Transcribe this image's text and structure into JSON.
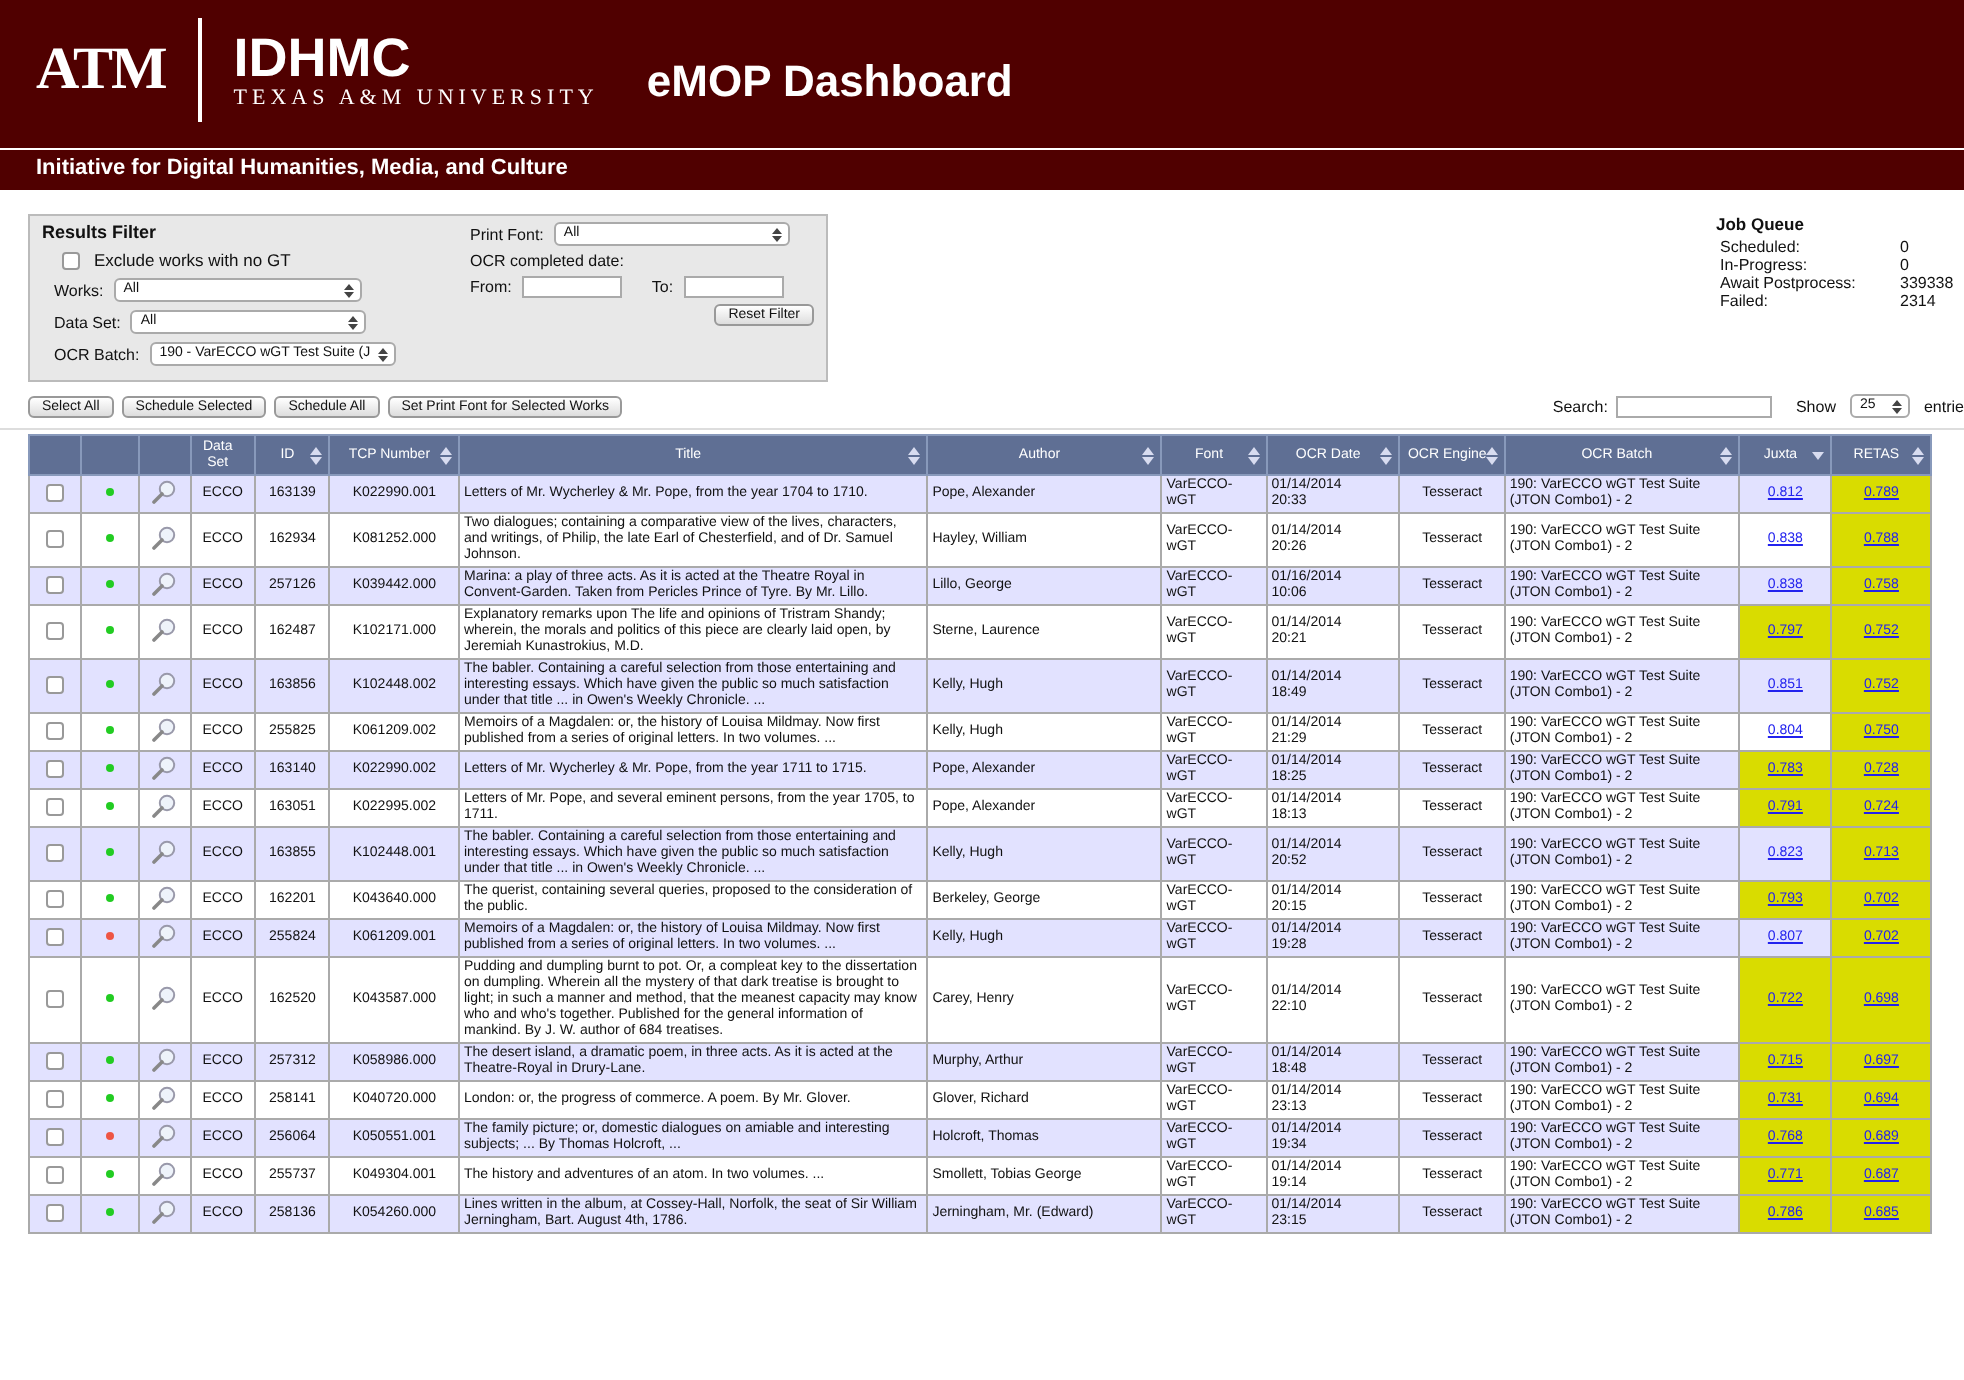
{
  "header": {
    "logo": "ATM",
    "org": "IDHMC",
    "university": "TEXAS A&M UNIVERSITY",
    "title": "eMOP Dashboard",
    "subtitle": "Initiative for Digital Humanities, Media, and Culture"
  },
  "filter": {
    "title": "Results Filter",
    "exclude": {
      "label": "Exclude works with no GT",
      "checked": false
    },
    "selects": [
      {
        "label": "Works:",
        "value": "All"
      },
      {
        "label": "Data Set:",
        "value": "All"
      },
      {
        "label": "OCR Batch:",
        "value": "190 - VarECCO wGT Test Suite (J"
      }
    ],
    "print_font": {
      "label": "Print Font:",
      "value": "All"
    },
    "date_label": "OCR completed date:",
    "from_label": "From:",
    "to_label": "To:",
    "reset": "Reset Filter"
  },
  "job_queue": {
    "title": "Job Queue",
    "items": [
      {
        "label": "Scheduled:",
        "value": "0"
      },
      {
        "label": "In-Progress:",
        "value": "0"
      },
      {
        "label": "Await Postprocess:",
        "value": "339338"
      },
      {
        "label": "Failed:",
        "value": "2314"
      }
    ]
  },
  "actions": [
    "Select All",
    "Schedule Selected",
    "Schedule All",
    "Set Print Font for Selected Works"
  ],
  "search_label": "Search:",
  "show_label": "Show",
  "show_value": "25",
  "entries_label": "entrie",
  "table": {
    "columns": [
      {
        "label": "Data Set",
        "sortable": false,
        "sorted": false
      },
      {
        "label": "ID",
        "sortable": true,
        "sorted": false
      },
      {
        "label": "TCP Number",
        "sortable": true,
        "sorted": false
      },
      {
        "label": "Title",
        "sortable": true,
        "sorted": false
      },
      {
        "label": "Author",
        "sortable": true,
        "sorted": false
      },
      {
        "label": "Font",
        "sortable": true,
        "sorted": false
      },
      {
        "label": "OCR Date",
        "sortable": true,
        "sorted": false
      },
      {
        "label": "OCR Engine",
        "sortable": true,
        "sorted": false
      },
      {
        "label": "OCR Batch",
        "sortable": true,
        "sorted": false
      },
      {
        "label": "Juxta",
        "sortable": true,
        "sorted": true
      },
      {
        "label": "RETAS",
        "sortable": true,
        "sorted": false
      }
    ],
    "rows": [
      {
        "checked": false,
        "color": "#22cc22",
        "dataset": "ECCO",
        "id": "163139",
        "tcp": "K022990.001",
        "title": "Letters of Mr. Wycherley & Mr. Pope, from the year 1704 to 1710.",
        "author": "Pope, Alexander",
        "font": "VarECCO-wGT",
        "date": "01/14/2014 20:33",
        "engine": "Tesseract",
        "batch": "190: VarECCO wGT Test Suite (JTON Combo1) - 2",
        "juxta": {
          "value": "0.812",
          "highlighted": false
        },
        "retas": {
          "value": "0.789",
          "highlighted": true
        }
      },
      {
        "checked": false,
        "color": "#22cc22",
        "dataset": "ECCO",
        "id": "162934",
        "tcp": "K081252.000",
        "title": "Two dialogues; containing a comparative view of the lives, characters, and writings, of Philip, the late Earl of Chesterfield, and of Dr. Samuel Johnson.",
        "author": "Hayley, William",
        "font": "VarECCO-wGT",
        "date": "01/14/2014 20:26",
        "engine": "Tesseract",
        "batch": "190: VarECCO wGT Test Suite (JTON Combo1) - 2",
        "juxta": {
          "value": "0.838",
          "highlighted": false
        },
        "retas": {
          "value": "0.788",
          "highlighted": true
        }
      },
      {
        "checked": false,
        "color": "#22cc22",
        "dataset": "ECCO",
        "id": "257126",
        "tcp": "K039442.000",
        "title": "Marina: a play of three acts. As it is acted at the Theatre Royal in Convent-Garden. Taken from Pericles Prince of Tyre. By Mr. Lillo.",
        "author": "Lillo, George",
        "font": "VarECCO-wGT",
        "date": "01/16/2014 10:06",
        "engine": "Tesseract",
        "batch": "190: VarECCO wGT Test Suite (JTON Combo1) - 2",
        "juxta": {
          "value": "0.838",
          "highlighted": false
        },
        "retas": {
          "value": "0.758",
          "highlighted": true
        }
      },
      {
        "checked": false,
        "color": "#22cc22",
        "dataset": "ECCO",
        "id": "162487",
        "tcp": "K102171.000",
        "title": "Explanatory remarks upon The life and opinions of Tristram Shandy; wherein, the morals and politics of this piece are clearly laid open, by Jeremiah Kunastrokius, M.D.",
        "author": "Sterne, Laurence",
        "font": "VarECCO-wGT",
        "date": "01/14/2014 20:21",
        "engine": "Tesseract",
        "batch": "190: VarECCO wGT Test Suite (JTON Combo1) - 2",
        "juxta": {
          "value": "0.797",
          "highlighted": true
        },
        "retas": {
          "value": "0.752",
          "highlighted": true
        }
      },
      {
        "checked": false,
        "color": "#22cc22",
        "dataset": "ECCO",
        "id": "163856",
        "tcp": "K102448.002",
        "title": "The babler. Containing a careful selection from those entertaining and interesting essays. Which have given the public so much satisfaction under that title ... in Owen's Weekly Chronicle. ...",
        "author": "Kelly, Hugh",
        "font": "VarECCO-wGT",
        "date": "01/14/2014 18:49",
        "engine": "Tesseract",
        "batch": "190: VarECCO wGT Test Suite (JTON Combo1) - 2",
        "juxta": {
          "value": "0.851",
          "highlighted": false
        },
        "retas": {
          "value": "0.752",
          "highlighted": true
        }
      },
      {
        "checked": false,
        "color": "#22cc22",
        "dataset": "ECCO",
        "id": "255825",
        "tcp": "K061209.002",
        "title": "Memoirs of a Magdalen: or, the history of Louisa Mildmay. Now first published from a series of original letters. In two volumes. ...",
        "author": "Kelly, Hugh",
        "font": "VarECCO-wGT",
        "date": "01/14/2014 21:29",
        "engine": "Tesseract",
        "batch": "190: VarECCO wGT Test Suite (JTON Combo1) - 2",
        "juxta": {
          "value": "0.804",
          "highlighted": false
        },
        "retas": {
          "value": "0.750",
          "highlighted": true
        }
      },
      {
        "checked": false,
        "color": "#22cc22",
        "dataset": "ECCO",
        "id": "163140",
        "tcp": "K022990.002",
        "title": "Letters of Mr. Wycherley & Mr. Pope, from the year 1711 to 1715.",
        "author": "Pope, Alexander",
        "font": "VarECCO-wGT",
        "date": "01/14/2014 18:25",
        "engine": "Tesseract",
        "batch": "190: VarECCO wGT Test Suite (JTON Combo1) - 2",
        "juxta": {
          "value": "0.783",
          "highlighted": true
        },
        "retas": {
          "value": "0.728",
          "highlighted": true
        }
      },
      {
        "checked": false,
        "color": "#22cc22",
        "dataset": "ECCO",
        "id": "163051",
        "tcp": "K022995.002",
        "title": "Letters of Mr. Pope, and several eminent persons, from the year 1705, to 1711.",
        "author": "Pope, Alexander",
        "font": "VarECCO-wGT",
        "date": "01/14/2014 18:13",
        "engine": "Tesseract",
        "batch": "190: VarECCO wGT Test Suite (JTON Combo1) - 2",
        "juxta": {
          "value": "0.791",
          "highlighted": true
        },
        "retas": {
          "value": "0.724",
          "highlighted": true
        }
      },
      {
        "checked": false,
        "color": "#22cc22",
        "dataset": "ECCO",
        "id": "163855",
        "tcp": "K102448.001",
        "title": "The babler. Containing a careful selection from those entertaining and interesting essays. Which have given the public so much satisfaction under that title ... in Owen's Weekly Chronicle. ...",
        "author": "Kelly, Hugh",
        "font": "VarECCO-wGT",
        "date": "01/14/2014 20:52",
        "engine": "Tesseract",
        "batch": "190: VarECCO wGT Test Suite (JTON Combo1) - 2",
        "juxta": {
          "value": "0.823",
          "highlighted": false
        },
        "retas": {
          "value": "0.713",
          "highlighted": true
        }
      },
      {
        "checked": false,
        "color": "#22cc22",
        "dataset": "ECCO",
        "id": "162201",
        "tcp": "K043640.000",
        "title": "The querist, containing several queries, proposed to the consideration of the public.",
        "author": "Berkeley, George",
        "font": "VarECCO-wGT",
        "date": "01/14/2014 20:15",
        "engine": "Tesseract",
        "batch": "190: VarECCO wGT Test Suite (JTON Combo1) - 2",
        "juxta": {
          "value": "0.793",
          "highlighted": true
        },
        "retas": {
          "value": "0.702",
          "highlighted": true
        }
      },
      {
        "checked": false,
        "color": "#ee5544",
        "dataset": "ECCO",
        "id": "255824",
        "tcp": "K061209.001",
        "title": "Memoirs of a Magdalen: or, the history of Louisa Mildmay. Now first published from a series of original letters. In two volumes. ...",
        "author": "Kelly, Hugh",
        "font": "VarECCO-wGT",
        "date": "01/14/2014 19:28",
        "engine": "Tesseract",
        "batch": "190: VarECCO wGT Test Suite (JTON Combo1) - 2",
        "juxta": {
          "value": "0.807",
          "highlighted": false
        },
        "retas": {
          "value": "0.702",
          "highlighted": true
        }
      },
      {
        "checked": false,
        "color": "#22cc22",
        "dataset": "ECCO",
        "id": "162520",
        "tcp": "K043587.000",
        "title": "Pudding and dumpling burnt to pot. Or, a compleat key to the dissertation on dumpling. Wherein all the mystery of that dark treatise is brought to light; in such a manner and method, that the meanest capacity may know who and who's together. Published for the general information of mankind. By J. W. author of 684 treatises.",
        "author": "Carey, Henry",
        "font": "VarECCO-wGT",
        "date": "01/14/2014 22:10",
        "engine": "Tesseract",
        "batch": "190: VarECCO wGT Test Suite (JTON Combo1) - 2",
        "juxta": {
          "value": "0.722",
          "highlighted": true
        },
        "retas": {
          "value": "0.698",
          "highlighted": true
        }
      },
      {
        "checked": false,
        "color": "#22cc22",
        "dataset": "ECCO",
        "id": "257312",
        "tcp": "K058986.000",
        "title": "The desert island, a dramatic poem, in three acts. As it is acted at the Theatre-Royal in Drury-Lane.",
        "author": "Murphy, Arthur",
        "font": "VarECCO-wGT",
        "date": "01/14/2014 18:48",
        "engine": "Tesseract",
        "batch": "190: VarECCO wGT Test Suite (JTON Combo1) - 2",
        "juxta": {
          "value": "0.715",
          "highlighted": true
        },
        "retas": {
          "value": "0.697",
          "highlighted": true
        }
      },
      {
        "checked": false,
        "color": "#22cc22",
        "dataset": "ECCO",
        "id": "258141",
        "tcp": "K040720.000",
        "title": "London: or, the progress of commerce. A poem. By Mr. Glover.",
        "author": "Glover, Richard",
        "font": "VarECCO-wGT",
        "date": "01/14/2014 23:13",
        "engine": "Tesseract",
        "batch": "190: VarECCO wGT Test Suite (JTON Combo1) - 2",
        "juxta": {
          "value": "0.731",
          "highlighted": true
        },
        "retas": {
          "value": "0.694",
          "highlighted": true
        }
      },
      {
        "checked": false,
        "color": "#ee5544",
        "dataset": "ECCO",
        "id": "256064",
        "tcp": "K050551.001",
        "title": "The family picture; or, domestic dialogues on amiable and interesting subjects; ... By Thomas Holcroft, ...",
        "author": "Holcroft, Thomas",
        "font": "VarECCO-wGT",
        "date": "01/14/2014 19:34",
        "engine": "Tesseract",
        "batch": "190: VarECCO wGT Test Suite (JTON Combo1) - 2",
        "juxta": {
          "value": "0.768",
          "highlighted": true
        },
        "retas": {
          "value": "0.689",
          "highlighted": true
        }
      },
      {
        "checked": false,
        "color": "#22cc22",
        "dataset": "ECCO",
        "id": "255737",
        "tcp": "K049304.001",
        "title": "The history and adventures of an atom. In two volumes. ...",
        "author": "Smollett, Tobias George",
        "font": "VarECCO-wGT",
        "date": "01/14/2014 19:14",
        "engine": "Tesseract",
        "batch": "190: VarECCO wGT Test Suite (JTON Combo1) - 2",
        "juxta": {
          "value": "0.771",
          "highlighted": true
        },
        "retas": {
          "value": "0.687",
          "highlighted": true
        }
      },
      {
        "checked": false,
        "color": "#22cc22",
        "dataset": "ECCO",
        "id": "258136",
        "tcp": "K054260.000",
        "title": "Lines written in the album, at Cossey-Hall, Norfolk, the seat of Sir William Jerningham, Bart. August 4th, 1786.",
        "author": "Jerningham, Mr. (Edward)",
        "font": "VarECCO-wGT",
        "date": "01/14/2014 23:15",
        "engine": "Tesseract",
        "batch": "190: VarECCO wGT Test Suite (JTON Combo1) - 2",
        "juxta": {
          "value": "0.786",
          "highlighted": true
        },
        "retas": {
          "value": "0.685",
          "highlighted": true
        }
      }
    ]
  }
}
